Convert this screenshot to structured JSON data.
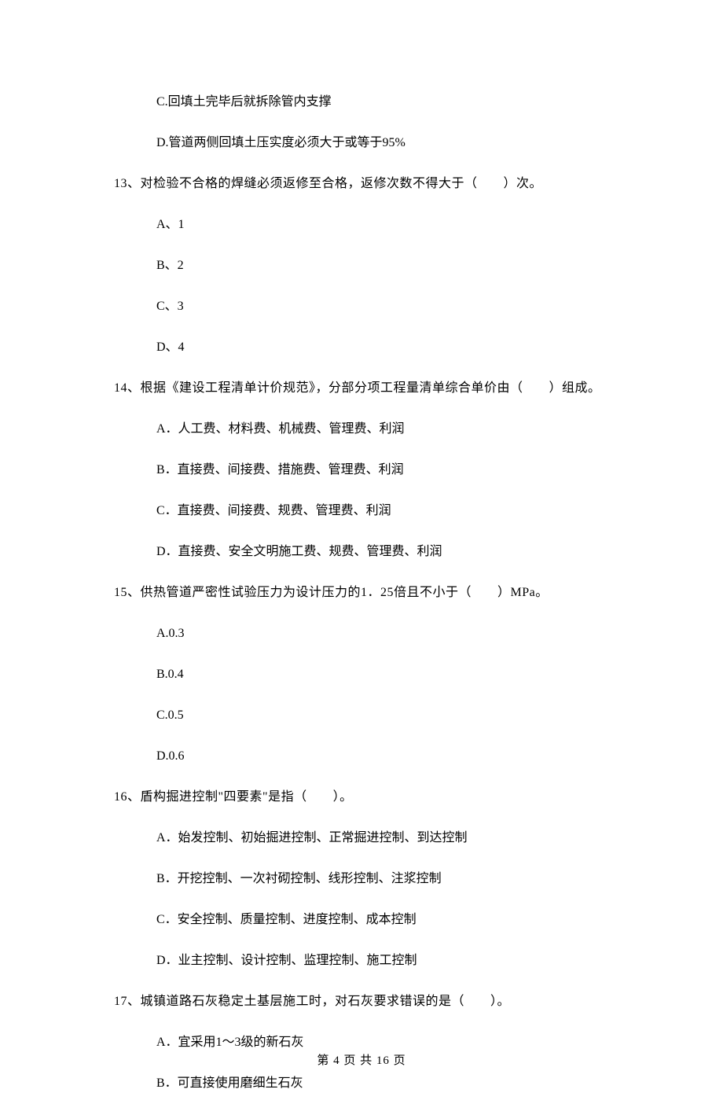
{
  "options_pre": [
    "C.回填土完毕后就拆除管内支撑",
    "D.管道两侧回填土压实度必须大于或等于95%"
  ],
  "questions": [
    {
      "stem": "13、对检验不合格的焊缝必须返修至合格，返修次数不得大于（　　）次。",
      "options": [
        "A、1",
        "B、2",
        "C、3",
        "D、4"
      ]
    },
    {
      "stem": "14、根据《建设工程清单计价规范》，分部分项工程量清单综合单价由（　　）组成。",
      "options": [
        "A．人工费、材料费、机械费、管理费、利润",
        "B．直接费、间接费、措施费、管理费、利润",
        "C．直接费、间接费、规费、管理费、利润",
        "D．直接费、安全文明施工费、规费、管理费、利润"
      ]
    },
    {
      "stem": "15、供热管道严密性试验压力为设计压力的1．25倍且不小于（　　）MPa。",
      "options": [
        "A.0.3",
        "B.0.4",
        "C.0.5",
        "D.0.6"
      ]
    },
    {
      "stem": "16、盾构掘进控制\"四要素\"是指（　　）。",
      "options": [
        "A．始发控制、初始掘进控制、正常掘进控制、到达控制",
        "B．开挖控制、一次衬砌控制、线形控制、注浆控制",
        "C．安全控制、质量控制、进度控制、成本控制",
        "D．业主控制、设计控制、监理控制、施工控制"
      ]
    },
    {
      "stem": "17、城镇道路石灰稳定土基层施工时，对石灰要求错误的是（　　）。",
      "options": [
        "A．宜采用1～3级的新石灰",
        "B．可直接使用磨细生石灰"
      ]
    }
  ],
  "footer": "第 4 页 共 16 页"
}
